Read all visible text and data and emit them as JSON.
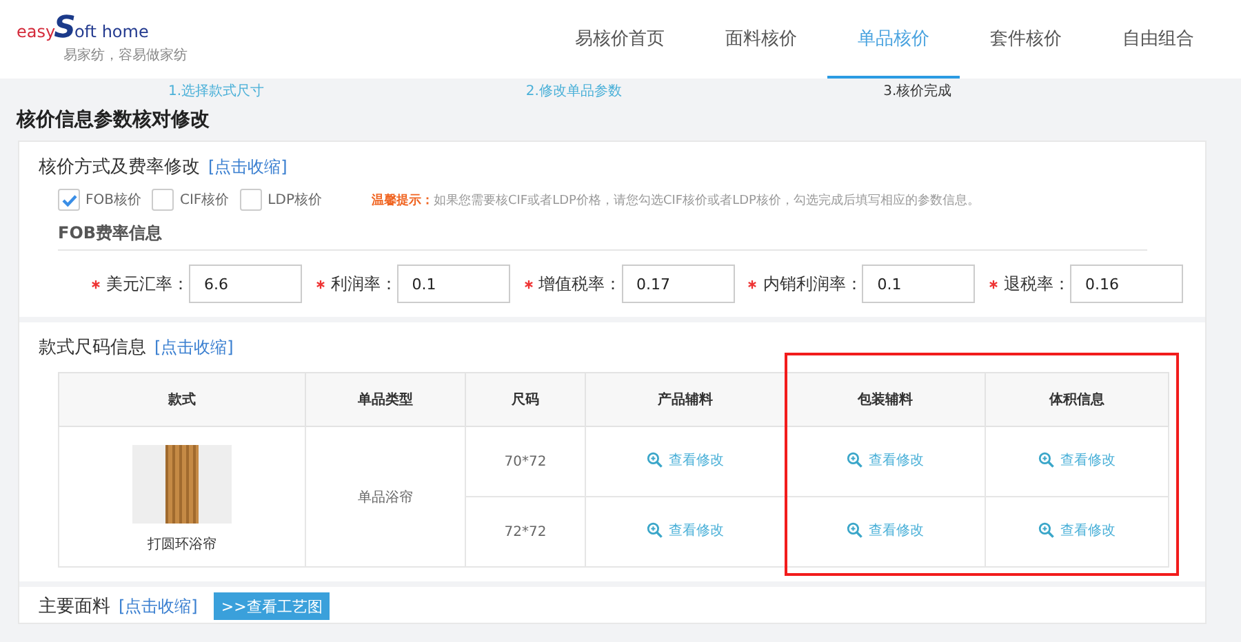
{
  "logo": {
    "brand_left": "easy",
    "brand_mark": "S",
    "brand_right": "oft home",
    "tagline": "易家纺，容易做家纺"
  },
  "nav": [
    {
      "label": "易核价首页",
      "selected": false
    },
    {
      "label": "面料核价",
      "selected": false
    },
    {
      "label": "单品核价",
      "selected": true
    },
    {
      "label": "套件核价",
      "selected": false
    },
    {
      "label": "自由组合",
      "selected": false
    }
  ],
  "steps": [
    {
      "label": "1.选择款式尺寸",
      "selected": false
    },
    {
      "label": "2.修改单品参数",
      "selected": false
    },
    {
      "label": "3.核价完成",
      "selected": true
    }
  ],
  "page_title": "核价信息参数核对修改",
  "pricing": {
    "title": "核价方式及费率修改",
    "toggle": "[点击收缩]",
    "methods": [
      {
        "label": "FOB核价",
        "checked": true
      },
      {
        "label": "CIF核价",
        "checked": false
      },
      {
        "label": "LDP核价",
        "checked": false
      }
    ],
    "hint_label": "温馨提示：",
    "hint_text": "如果您需要核CIF或者LDP价格，请您勾选CIF核价或者LDP核价，勾选完成后填写相应的参数信息。",
    "subtitle": "FOB费率信息",
    "fields": [
      {
        "label": "美元汇率：",
        "value": "6.6",
        "required": true
      },
      {
        "label": "利润率：",
        "value": "0.1",
        "required": true
      },
      {
        "label": "增值税率：",
        "value": "0.17",
        "required": true
      },
      {
        "label": "内销利润率：",
        "value": "0.1",
        "required": true
      },
      {
        "label": "退税率：",
        "value": "0.16",
        "required": true
      }
    ]
  },
  "sizes": {
    "title": "款式尺码信息",
    "toggle": "[点击收缩]",
    "columns": [
      "款式",
      "单品类型",
      "尺码",
      "产品辅料",
      "包装辅料",
      "体积信息"
    ],
    "groups": [
      {
        "style": "打圆环浴帘",
        "type": "单品浴帘",
        "rows": [
          {
            "size": "70*72",
            "actions": [
              "查看修改",
              "查看修改",
              "查看修改"
            ]
          },
          {
            "size": "72*72",
            "actions": [
              "查看修改",
              "查看修改",
              "查看修改"
            ]
          }
        ]
      }
    ]
  },
  "fabric": {
    "title": "主要面料",
    "toggle": "[点击收缩]",
    "button": ">>查看工艺图"
  }
}
